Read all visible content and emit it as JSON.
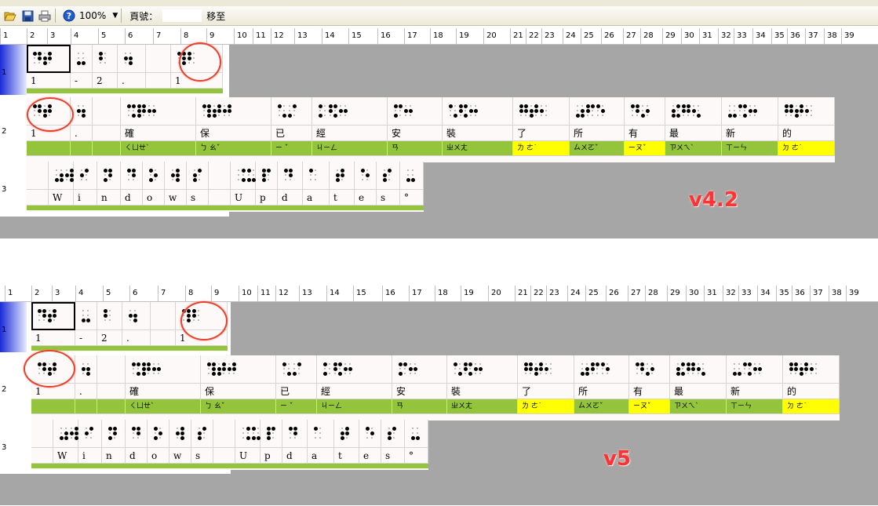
{
  "toolbar": {
    "open_icon": "folder-open-icon",
    "save_icon": "save-disk-icon",
    "print_icon": "printer-icon",
    "help_icon": "help-icon",
    "zoom": "100%",
    "page_label": "頁號：",
    "page_value": "",
    "goto_label": "移至"
  },
  "ruler": [
    "1",
    "2",
    "3",
    "4",
    "5",
    "6",
    "7",
    "8",
    "9",
    "10",
    "11",
    "12",
    "13",
    "14",
    "15",
    "16",
    "17",
    "18",
    "19",
    "20",
    "21",
    "22",
    "23",
    "24",
    "25",
    "26",
    "27",
    "28",
    "29",
    "30",
    "31",
    "32",
    "33",
    "34",
    "35",
    "36",
    "37",
    "38",
    "39"
  ],
  "colors": {
    "green": "#93c43c",
    "yellow": "#ffff00",
    "circle": "#e8412c",
    "label": "#ff3333",
    "gray": "#a6a6a6"
  },
  "panels": [
    {
      "version": "v4.2",
      "rows": [
        {
          "label": "1",
          "cells": [
            {
              "dots": "145 2345",
              "text": "1",
              "zhuyin": "",
              "yellow": false,
              "selected": true
            },
            {
              "dots": "36",
              "text": "-",
              "zhuyin": "",
              "yellow": false
            },
            {
              "dots": "12",
              "text": "2",
              "zhuyin": "",
              "yellow": false
            },
            {
              "dots": "256",
              "text": ".",
              "zhuyin": "",
              "yellow": false
            },
            {
              "dots": "",
              "text": "",
              "zhuyin": "",
              "yellow": false
            },
            {
              "dots": "1456 12",
              "text": "1",
              "zhuyin": "",
              "yellow": false
            }
          ]
        },
        {
          "label": "2",
          "cells": [
            {
              "dots": "145 2345",
              "text": "1",
              "zhuyin": "",
              "yellow": false
            },
            {
              "dots": "256",
              "text": ".",
              "zhuyin": "",
              "yellow": false
            },
            {
              "dots": "",
              "text": "",
              "zhuyin": "",
              "yellow": false
            },
            {
              "dots": "146 12345 25",
              "text": "確",
              "zhuyin": "ㄑㄩㄝˋ",
              "yellow": false
            },
            {
              "dots": "1456 2345 245",
              "text": "保",
              "zhuyin": "ㄅ ㄠˇ",
              "yellow": false
            },
            {
              "dots": "16 34",
              "text": "已",
              "zhuyin": "ㄧ ˇ",
              "yellow": false
            },
            {
              "dots": "13 1246 25",
              "text": "經",
              "zhuyin": "ㄐㄧㄥ",
              "yellow": false
            },
            {
              "dots": "134 25",
              "text": "安",
              "zhuyin": "ㄢ",
              "yellow": false
            },
            {
              "dots": "16 1246 25",
              "text": "裝",
              "zhuyin": "ㄓㄨㄤ",
              "yellow": false
            },
            {
              "dots": "1245 2345 2",
              "text": "了",
              "zhuyin": "ㄌ ㄜ˙",
              "yellow": true
            },
            {
              "dots": "356 124 15",
              "text": "所",
              "zhuyin": "ㄙㄨㄛˇ",
              "yellow": false
            },
            {
              "dots": "145 35",
              "text": "有",
              "zhuyin": "ㄧㄡˇ",
              "yellow": true
            },
            {
              "dots": "2346 1245 26",
              "text": "最",
              "zhuyin": "ㄗㄨㄟˋ",
              "yellow": false
            },
            {
              "dots": "36 146 25",
              "text": "新",
              "zhuyin": "ㄒㄧㄣ",
              "yellow": false
            },
            {
              "dots": "1245 2345 2",
              "text": "的",
              "zhuyin": "ㄉ ㄜ˙",
              "yellow": true
            }
          ]
        },
        {
          "label": "3",
          "cells": [
            {
              "dots": "",
              "text": "",
              "zhuyin": "",
              "yellow": false
            },
            {
              "dots": "356 2456",
              "text": "W",
              "zhuyin": "",
              "yellow": false
            },
            {
              "dots": "24",
              "text": "i",
              "zhuyin": "",
              "yellow": false
            },
            {
              "dots": "1345",
              "text": "n",
              "zhuyin": "",
              "yellow": false
            },
            {
              "dots": "145",
              "text": "d",
              "zhuyin": "",
              "yellow": false
            },
            {
              "dots": "135",
              "text": "o",
              "zhuyin": "",
              "yellow": false
            },
            {
              "dots": "2456",
              "text": "w",
              "zhuyin": "",
              "yellow": false
            },
            {
              "dots": "234",
              "text": "s",
              "zhuyin": "",
              "yellow": false
            },
            {
              "dots": "",
              "text": "",
              "zhuyin": "",
              "yellow": false
            },
            {
              "dots": "46 136",
              "text": "U",
              "zhuyin": "",
              "yellow": false
            },
            {
              "dots": "1234",
              "text": "p",
              "zhuyin": "",
              "yellow": false
            },
            {
              "dots": "145",
              "text": "d",
              "zhuyin": "",
              "yellow": false
            },
            {
              "dots": "1",
              "text": "a",
              "zhuyin": "",
              "yellow": false
            },
            {
              "dots": "2345",
              "text": "t",
              "zhuyin": "",
              "yellow": false
            },
            {
              "dots": "15",
              "text": "e",
              "zhuyin": "",
              "yellow": false
            },
            {
              "dots": "234",
              "text": "s",
              "zhuyin": "",
              "yellow": false
            },
            {
              "dots": "36",
              "text": "°",
              "zhuyin": "",
              "yellow": false
            }
          ]
        }
      ]
    },
    {
      "version": "v5",
      "rows": [
        {
          "label": "1",
          "cells": [
            {
              "dots": "145 2345",
              "text": "1",
              "zhuyin": "",
              "yellow": false,
              "selected": true
            },
            {
              "dots": "36",
              "text": "-",
              "zhuyin": "",
              "yellow": false
            },
            {
              "dots": "12",
              "text": "2",
              "zhuyin": "",
              "yellow": false
            },
            {
              "dots": "256",
              "text": ".",
              "zhuyin": "",
              "yellow": false
            },
            {
              "dots": "",
              "text": "",
              "zhuyin": "",
              "yellow": false
            },
            {
              "dots": "1456 12",
              "text": "1",
              "zhuyin": "",
              "yellow": false
            }
          ]
        },
        {
          "label": "2",
          "cells": [
            {
              "dots": "145 2345",
              "text": "1",
              "zhuyin": "",
              "yellow": false
            },
            {
              "dots": "256",
              "text": ".",
              "zhuyin": "",
              "yellow": false
            },
            {
              "dots": "",
              "text": "",
              "zhuyin": "",
              "yellow": false
            },
            {
              "dots": "146 12345 25",
              "text": "確",
              "zhuyin": "ㄑㄩㄝˋ",
              "yellow": false
            },
            {
              "dots": "1456 2345 245",
              "text": "保",
              "zhuyin": "ㄅ ㄠˇ",
              "yellow": false
            },
            {
              "dots": "16 34",
              "text": "已",
              "zhuyin": "ㄧ ˇ",
              "yellow": false
            },
            {
              "dots": "13 1246 25",
              "text": "經",
              "zhuyin": "ㄐㄧㄥ",
              "yellow": false
            },
            {
              "dots": "134 25",
              "text": "安",
              "zhuyin": "ㄢ",
              "yellow": false
            },
            {
              "dots": "16 1246 25",
              "text": "裝",
              "zhuyin": "ㄓㄨㄤ",
              "yellow": false
            },
            {
              "dots": "1245 2345 2",
              "text": "了",
              "zhuyin": "ㄌ ㄜ˙",
              "yellow": true
            },
            {
              "dots": "356 124 15",
              "text": "所",
              "zhuyin": "ㄙㄨㄛˇ",
              "yellow": false
            },
            {
              "dots": "145 35",
              "text": "有",
              "zhuyin": "ㄧㄡˇ",
              "yellow": true
            },
            {
              "dots": "2346 1245 26",
              "text": "最",
              "zhuyin": "ㄗㄨㄟˋ",
              "yellow": false
            },
            {
              "dots": "36 146 25",
              "text": "新",
              "zhuyin": "ㄒㄧㄣ",
              "yellow": false
            },
            {
              "dots": "1245 2345 2",
              "text": "的",
              "zhuyin": "ㄉ ㄜ˙",
              "yellow": true
            }
          ]
        },
        {
          "label": "3",
          "cells": [
            {
              "dots": "",
              "text": "",
              "zhuyin": "",
              "yellow": false
            },
            {
              "dots": "356 2456",
              "text": "W",
              "zhuyin": "",
              "yellow": false
            },
            {
              "dots": "24",
              "text": "i",
              "zhuyin": "",
              "yellow": false
            },
            {
              "dots": "1345",
              "text": "n",
              "zhuyin": "",
              "yellow": false
            },
            {
              "dots": "145",
              "text": "d",
              "zhuyin": "",
              "yellow": false
            },
            {
              "dots": "135",
              "text": "o",
              "zhuyin": "",
              "yellow": false
            },
            {
              "dots": "2456",
              "text": "w",
              "zhuyin": "",
              "yellow": false
            },
            {
              "dots": "234",
              "text": "s",
              "zhuyin": "",
              "yellow": false
            },
            {
              "dots": "",
              "text": "",
              "zhuyin": "",
              "yellow": false
            },
            {
              "dots": "46 136",
              "text": "U",
              "zhuyin": "",
              "yellow": false
            },
            {
              "dots": "1234",
              "text": "p",
              "zhuyin": "",
              "yellow": false
            },
            {
              "dots": "145",
              "text": "d",
              "zhuyin": "",
              "yellow": false
            },
            {
              "dots": "1",
              "text": "a",
              "zhuyin": "",
              "yellow": false
            },
            {
              "dots": "2345",
              "text": "t",
              "zhuyin": "",
              "yellow": false
            },
            {
              "dots": "15",
              "text": "e",
              "zhuyin": "",
              "yellow": false
            },
            {
              "dots": "234",
              "text": "s",
              "zhuyin": "",
              "yellow": false
            },
            {
              "dots": "36",
              "text": "°",
              "zhuyin": "",
              "yellow": false
            }
          ]
        }
      ]
    }
  ]
}
